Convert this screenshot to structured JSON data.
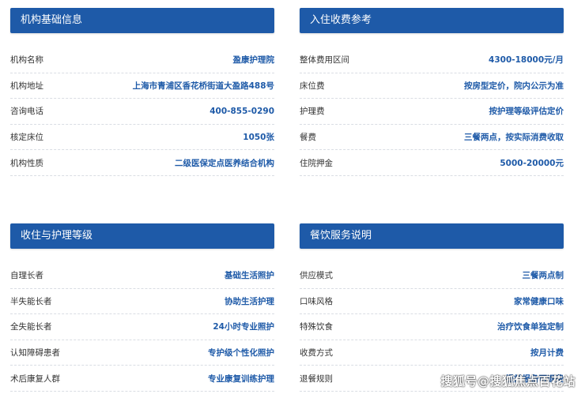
{
  "colors": {
    "accent": "#1e5aa8",
    "text": "#333333",
    "divider": "#d9dde3"
  },
  "info": {
    "title": "机构基础信息",
    "rows": [
      {
        "label": "机构名称",
        "value": "盈康护理院"
      },
      {
        "label": "机构地址",
        "value": "上海市青浦区香花桥街道大盈路488号"
      },
      {
        "label": "咨询电话",
        "value": "400-855-0290"
      },
      {
        "label": "核定床位",
        "value": "1050张"
      },
      {
        "label": "机构性质",
        "value": "二级医保定点医养结合机构"
      }
    ]
  },
  "fees": {
    "title": "入住收费参考",
    "rows": [
      {
        "label": "整体费用区间",
        "value": "4300-18000元/月"
      },
      {
        "label": "床位费",
        "value": "按房型定价，院内公示为准"
      },
      {
        "label": "护理费",
        "value": "按护理等级评估定价"
      },
      {
        "label": "餐费",
        "value": "三餐两点，按实际消费收取"
      },
      {
        "label": "住院押金",
        "value": "5000-20000元"
      }
    ]
  },
  "levels": {
    "title": "收住与护理等级",
    "rows": [
      {
        "label": "自理长者",
        "value": "基础生活照护"
      },
      {
        "label": "半失能长者",
        "value": "协助生活护理"
      },
      {
        "label": "全失能长者",
        "value": "24小时专业照护"
      },
      {
        "label": "认知障碍患者",
        "value": "专护级个性化照护"
      },
      {
        "label": "术后康复人群",
        "value": "专业康复训练护理"
      }
    ]
  },
  "dining": {
    "title": "餐饮服务说明",
    "rows": [
      {
        "label": "供应模式",
        "value": "三餐两点制"
      },
      {
        "label": "口味风格",
        "value": "家常健康口味"
      },
      {
        "label": "特殊饮食",
        "value": "治疗饮食单独定制"
      },
      {
        "label": "收费方式",
        "value": "按月计费"
      },
      {
        "label": "退餐规则",
        "value": "提前报备可退费"
      }
    ]
  },
  "watermark": {
    "text": "搜狐号@搜狐焦点百花站"
  }
}
